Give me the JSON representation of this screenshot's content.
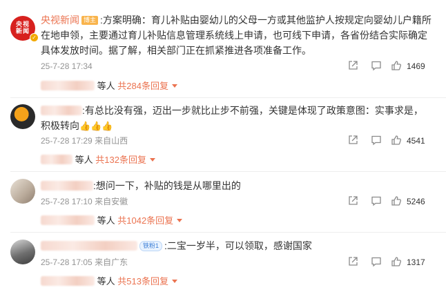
{
  "comments": [
    {
      "username": "央视新闻",
      "badge": "博主",
      "avatar_text": [
        "央视",
        "新闻"
      ],
      "text": ":方案明确：育儿补贴由婴幼儿的父母一方或其他监护人按规定向婴幼儿户籍所在地申领，主要通过育儿补贴信息管理系统线上申请，也可线下申请，各省份结合实际确定具体发放时间。据了解，相关部门正在抓紧推进各项准备工作。",
      "time": "25-7-28 17:34",
      "location": "",
      "likes": "1469",
      "reply_suffix": "等人",
      "reply_total": "共284条回复"
    },
    {
      "text": ":有总比没有强，迈出一步就比止步不前强，关键是体现了政策意图：实事求是，积极转向",
      "emoji": "👍👍👍",
      "time": "25-7-28 17:29",
      "location": "来自山西",
      "likes": "4541",
      "reply_suffix": "等人",
      "reply_total": "共132条回复"
    },
    {
      "text": ":想问一下，补贴的钱是从哪里出的",
      "time": "25-7-28 17:10",
      "location": "来自安徽",
      "likes": "5246",
      "reply_suffix": "等人",
      "reply_total": "共1042条回复"
    },
    {
      "badge": "铁粉1",
      "text": ":二宝一岁半，可以领取，感谢国家",
      "time": "25-7-28 17:05",
      "location": "来自广东",
      "likes": "1317",
      "reply_suffix": "等人",
      "reply_total": "共513条回复"
    }
  ],
  "colors": {
    "accent": "#eb7350",
    "meta": "#939393",
    "verified": "#f2a900"
  },
  "icons": [
    "share-icon",
    "comment-icon",
    "like-icon",
    "verified-icon",
    "caret-down-icon"
  ]
}
